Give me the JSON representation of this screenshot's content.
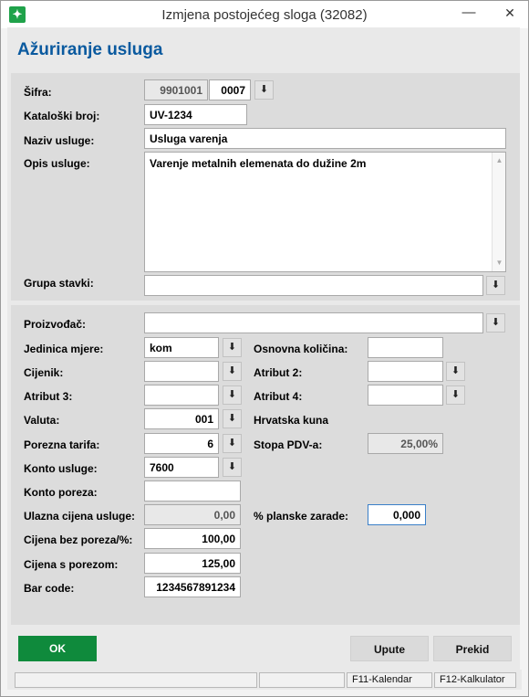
{
  "window": {
    "title": "Izmjena postojećeg sloga (32082)",
    "minimize_glyph": "—",
    "close_glyph": "✕",
    "app_icon_glyph": "✦"
  },
  "header": {
    "title": "Ažuriranje usluga"
  },
  "form": {
    "sifra": {
      "label": "Šifra:",
      "value1": "9901001",
      "value2": "0007"
    },
    "kataloski_broj": {
      "label": "Kataloški broj:",
      "value": "UV-1234"
    },
    "naziv_usluge": {
      "label": "Naziv usluge:",
      "value": "Usluga varenja"
    },
    "opis_usluge": {
      "label": "Opis usluge:",
      "value": "Varenje metalnih elemenata do dužine 2m"
    },
    "grupa_stavki": {
      "label": "Grupa stavki:",
      "value": ""
    },
    "proizvodjac": {
      "label": "Proizvođač:",
      "value": ""
    },
    "jedinica_mjere": {
      "label": "Jedinica mjere:",
      "value": "kom"
    },
    "osnovna_kolicina": {
      "label": "Osnovna količina:",
      "value": ""
    },
    "cjenik": {
      "label": "Cijenik:",
      "value": ""
    },
    "atribut2": {
      "label": "Atribut 2:",
      "value": ""
    },
    "atribut3": {
      "label": "Atribut 3:",
      "value": ""
    },
    "atribut4": {
      "label": "Atribut 4:",
      "value": ""
    },
    "valuta": {
      "label": "Valuta:",
      "value": "001",
      "description": "Hrvatska kuna"
    },
    "porezna_tarifa": {
      "label": "Porezna tarifa:",
      "value": "6"
    },
    "stopa_pdv": {
      "label": "Stopa PDV-a:",
      "value": "25,00%"
    },
    "konto_usluge": {
      "label": "Konto usluge:",
      "value": "7600"
    },
    "konto_poreza": {
      "label": "Konto poreza:",
      "value": ""
    },
    "ulazna_cijena": {
      "label": "Ulazna cijena usluge:",
      "value": "0,00"
    },
    "planske_zarade": {
      "label": "% planske zarade:",
      "value": "0,000"
    },
    "cijena_bez_poreza": {
      "label": "Cijena bez poreza/%:",
      "value": "100,00"
    },
    "cijena_s_porezom": {
      "label": "Cijena s porezom:",
      "value": "125,00"
    },
    "bar_code": {
      "label": "Bar code:",
      "value": "1234567891234"
    }
  },
  "buttons": {
    "ok": "OK",
    "upute": "Upute",
    "prekid": "Prekid"
  },
  "statusbar": {
    "f11": "F11-Kalendar",
    "f12": "F12-Kalkulator"
  },
  "icons": {
    "dropdown": "download-arrow-icon"
  }
}
